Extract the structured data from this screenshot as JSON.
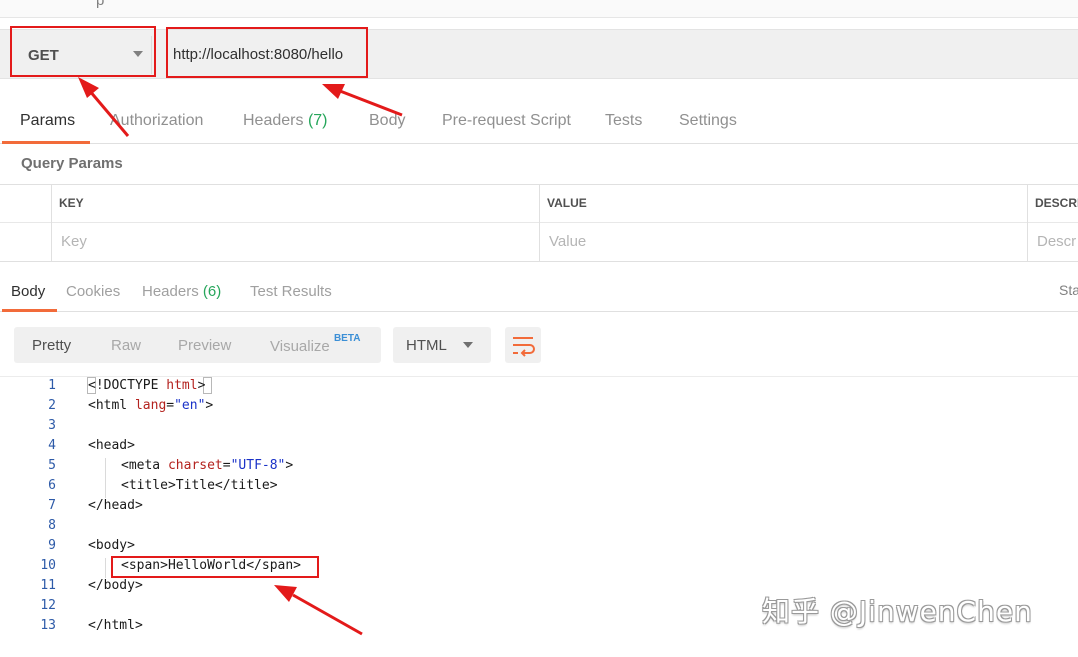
{
  "request": {
    "top_fragment": "p",
    "method": "GET",
    "url": "http://localhost:8080/hello"
  },
  "request_tabs": [
    {
      "label": "Params",
      "count": ""
    },
    {
      "label": "Authorization",
      "count": ""
    },
    {
      "label": "Headers",
      "count": "(7)"
    },
    {
      "label": "Body",
      "count": ""
    },
    {
      "label": "Pre-request Script",
      "count": ""
    },
    {
      "label": "Tests",
      "count": ""
    },
    {
      "label": "Settings",
      "count": ""
    }
  ],
  "query_params": {
    "title": "Query Params",
    "headers": [
      "KEY",
      "VALUE",
      "DESCRI"
    ],
    "placeholders": [
      "Key",
      "Value",
      "Descr"
    ]
  },
  "response_tabs": [
    {
      "label": "Body",
      "count": ""
    },
    {
      "label": "Cookies",
      "count": ""
    },
    {
      "label": "Headers",
      "count": "(6)"
    },
    {
      "label": "Test Results",
      "count": ""
    }
  ],
  "status_fragment": "Sta",
  "format_buttons": [
    "Pretty",
    "Raw",
    "Preview",
    "Visualize"
  ],
  "beta_badge": "BETA",
  "language": "HTML",
  "code_lines": [
    "1",
    "2",
    "3",
    "4",
    "5",
    "6",
    "7",
    "8",
    "9",
    "10",
    "11",
    "12",
    "13"
  ],
  "code": {
    "l1_a": "<!DOCTYPE ",
    "l1_b": "html",
    "l1_c": ">",
    "l2_a": "<html ",
    "l2_b": "lang",
    "l2_c": "=",
    "l2_d": "\"en\"",
    "l2_e": ">",
    "l4": "<head>",
    "l5_a": "<meta ",
    "l5_b": "charset",
    "l5_c": "=",
    "l5_d": "\"UTF-8\"",
    "l5_e": ">",
    "l6": "<title>Title</title>",
    "l7": "</head>",
    "l9": "<body>",
    "l10": "<span>HelloWorld</span>",
    "l11": "</body>",
    "l13": "</html>"
  },
  "watermark": "知乎 @JinwenChen",
  "colors": {
    "accent": "#f26b3a",
    "highlight_red": "#e31a1a",
    "count_green": "#26a65b",
    "beta_blue": "#3b8fd6"
  }
}
